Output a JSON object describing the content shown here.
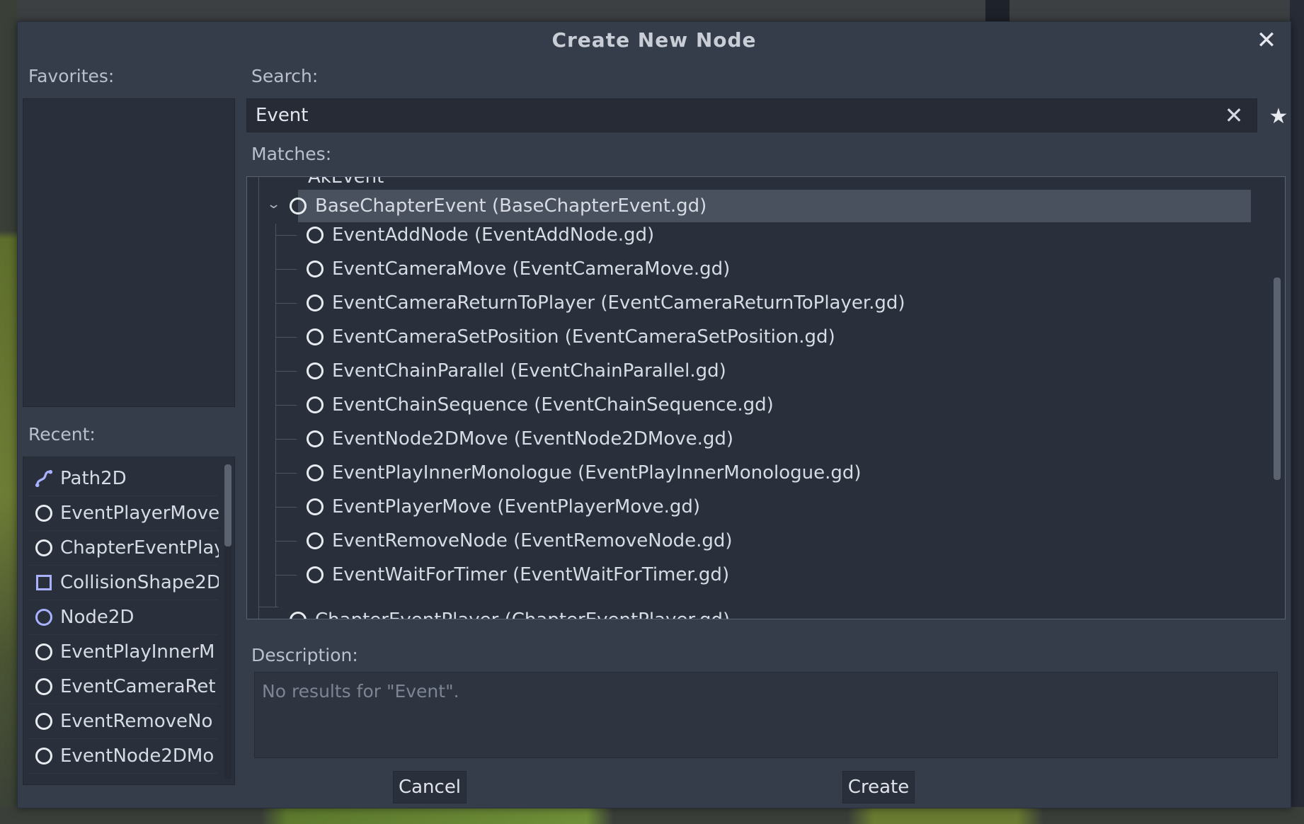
{
  "dialog": {
    "title": "Create New Node",
    "close_icon": "close-icon"
  },
  "favorites": {
    "label": "Favorites:"
  },
  "recent": {
    "label": "Recent:",
    "items": [
      {
        "label": "Path2D",
        "icon": "path2d-icon"
      },
      {
        "label": "EventPlayerMove",
        "icon": "script-node-icon"
      },
      {
        "label": "ChapterEventPlay",
        "icon": "script-node-icon"
      },
      {
        "label": "CollisionShape2D",
        "icon": "collision-shape-icon"
      },
      {
        "label": "Node2D",
        "icon": "node2d-icon"
      },
      {
        "label": "EventPlayInnerM",
        "icon": "script-node-icon"
      },
      {
        "label": "EventCameraRet",
        "icon": "script-node-icon"
      },
      {
        "label": "EventRemoveNo",
        "icon": "script-node-icon"
      },
      {
        "label": "EventNode2DMo",
        "icon": "script-node-icon"
      }
    ]
  },
  "search": {
    "label": "Search:",
    "value": "Event",
    "clear_icon": "clear-icon",
    "favorite_icon": "star-icon"
  },
  "matches": {
    "label": "Matches:",
    "partial_top": "AkEvent",
    "selected": "BaseChapterEvent (BaseChapterEvent.gd)",
    "children": [
      "EventAddNode (EventAddNode.gd)",
      "EventCameraMove (EventCameraMove.gd)",
      "EventCameraReturnToPlayer (EventCameraReturnToPlayer.gd)",
      "EventCameraSetPosition (EventCameraSetPosition.gd)",
      "EventChainParallel (EventChainParallel.gd)",
      "EventChainSequence (EventChainSequence.gd)",
      "EventNode2DMove (EventNode2DMove.gd)",
      "EventPlayInnerMonologue (EventPlayInnerMonologue.gd)",
      "EventPlayerMove (EventPlayerMove.gd)",
      "EventRemoveNode (EventRemoveNode.gd)",
      "EventWaitForTimer (EventWaitForTimer.gd)"
    ],
    "partial_bottom": "ChapterEventPlayer (ChapterEventPlayer.gd)"
  },
  "description": {
    "label": "Description:",
    "text": "No results for \"Event\"."
  },
  "buttons": {
    "cancel": "Cancel",
    "create": "Create"
  }
}
